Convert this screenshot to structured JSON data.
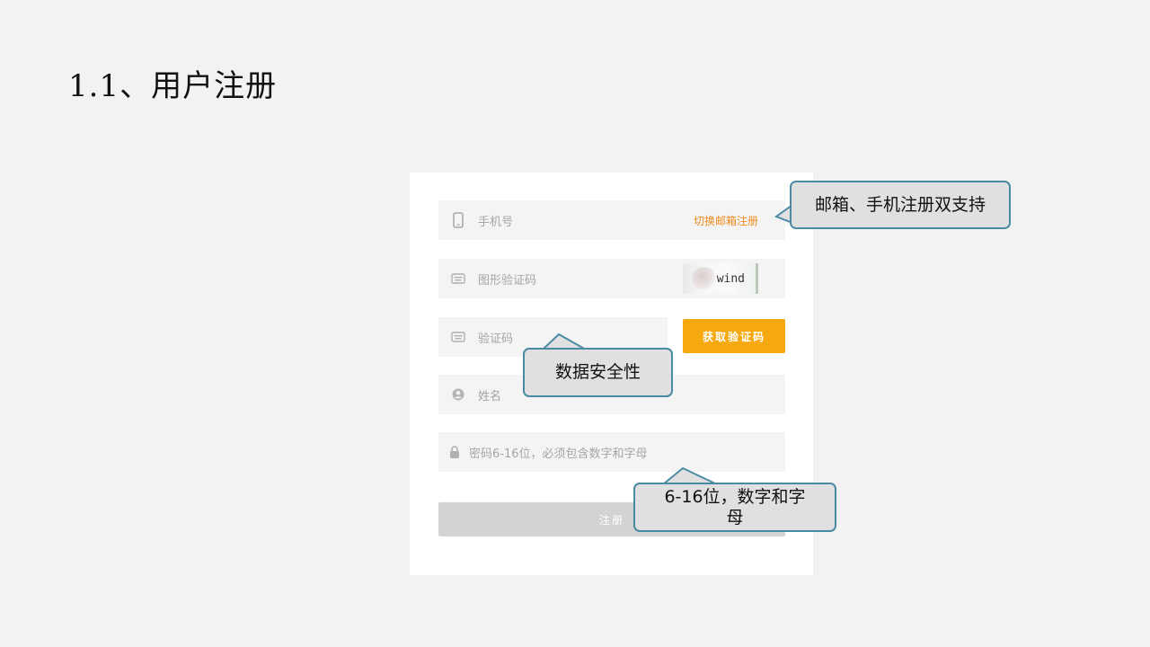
{
  "slide": {
    "title": "1.1、用户注册"
  },
  "form": {
    "phone": {
      "placeholder": "手机号",
      "switch_link": "切换邮箱注册"
    },
    "captcha": {
      "placeholder": "图形验证码",
      "image_text": "wind"
    },
    "sms": {
      "placeholder": "验证码",
      "button": "获取验证码"
    },
    "name": {
      "placeholder": "姓名"
    },
    "password": {
      "placeholder": "密码6-16位，必须包含数字和字母"
    },
    "submit": "注册"
  },
  "callouts": {
    "dual_register": "邮箱、手机注册双支持",
    "data_security": "数据安全性",
    "password_rule_line1": "6-16位，数字和字",
    "password_rule_line2": "母"
  },
  "colors": {
    "accent_orange": "#f08a1c",
    "button_yellow": "#f6a90e",
    "callout_border": "#4a8aa3",
    "callout_fill": "#e0e0e0"
  }
}
